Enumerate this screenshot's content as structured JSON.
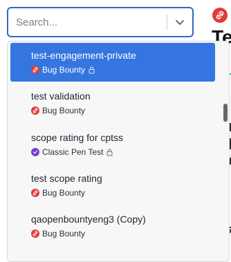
{
  "search": {
    "placeholder": "Search..."
  },
  "background": {
    "title_fragment": "Te",
    "bottom_fragment": "S"
  },
  "options": [
    {
      "title": "test-engagement-private",
      "type": "Bug Bounty",
      "type_color": "#e23b3b",
      "private": true,
      "selected": true
    },
    {
      "title": "test validation",
      "type": "Bug Bounty",
      "type_color": "#e23b3b",
      "private": false,
      "selected": false
    },
    {
      "title": "scope rating for cptss",
      "type": "Classic Pen Test",
      "type_color": "#7b3fd3",
      "private": true,
      "selected": false
    },
    {
      "title": "test scope rating",
      "type": "Bug Bounty",
      "type_color": "#e23b3b",
      "private": false,
      "selected": false
    },
    {
      "title": "qaopenbountyeng3 (Copy)",
      "type": "Bug Bounty",
      "type_color": "#e23b3b",
      "private": false,
      "selected": false
    }
  ],
  "colors": {
    "accent": "#3366cc",
    "selected_bg": "#3575e0",
    "bug_bounty": "#e23b3b",
    "classic_pen_test": "#7b3fd3"
  },
  "icons": {
    "type_bug_bounty": "link-icon",
    "type_classic_pen_test": "check-icon",
    "private": "lock-icon",
    "toggle": "chevron-down-icon"
  }
}
